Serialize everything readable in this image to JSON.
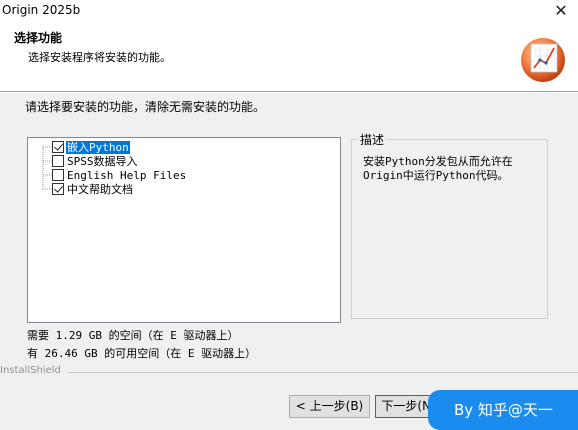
{
  "window": {
    "title": "Origin 2025b",
    "close_glyph": "✕"
  },
  "header": {
    "title": "选择功能",
    "subtitle": "选择安装程序将安装的功能。",
    "logo_icon": "origin-chart-logo-icon"
  },
  "instruction": "请选择要安装的功能，清除无需安装的功能。",
  "features": [
    {
      "label": "嵌入Python",
      "checked": true,
      "selected": true
    },
    {
      "label": "SPSS数据导入",
      "checked": false,
      "selected": false
    },
    {
      "label": "English Help Files",
      "checked": false,
      "selected": false
    },
    {
      "label": "中文帮助文档",
      "checked": true,
      "selected": false
    }
  ],
  "description": {
    "title": "描述",
    "text": "安装Python分发包从而允许在Origin中运行Python代码。"
  },
  "space": {
    "required": "需要 1.29 GB 的空间（在 E 驱动器上）",
    "available": "有 26.46 GB 的可用空间（在 E 驱动器上）"
  },
  "footer_brand": "InstallShield",
  "buttons": {
    "back": "< 上一步(B)",
    "next": "下一步(N) >"
  },
  "watermark": "By 知乎@天一"
}
